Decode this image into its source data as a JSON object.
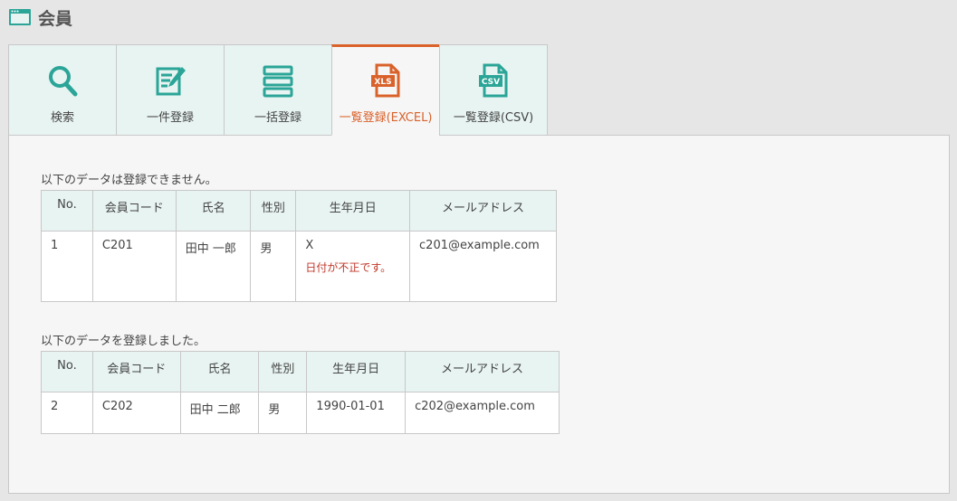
{
  "page": {
    "title": "会員"
  },
  "tabs": [
    {
      "label": "検索",
      "icon": "search-icon"
    },
    {
      "label": "一件登録",
      "icon": "edit-icon"
    },
    {
      "label": "一括登録",
      "icon": "list-icon"
    },
    {
      "label": "一覧登録(EXCEL)",
      "icon": "xls-file-icon",
      "icon_text": "XLS"
    },
    {
      "label": "一覧登録(CSV)",
      "icon": "csv-file-icon",
      "icon_text": "CSV"
    }
  ],
  "active_tab": "一覧登録(EXCEL)",
  "colors": {
    "accent": "#d9622b",
    "teal": "#2aa597",
    "error": "#c0392b"
  },
  "failed": {
    "message": "以下のデータは登録できません。",
    "headers": [
      "No.",
      "会員コード",
      "氏名",
      "性別",
      "生年月日",
      "メールアドレス"
    ],
    "rows": [
      {
        "no": "1",
        "code": "C201",
        "name": "田中 一郎",
        "gender": "男",
        "birth": "X",
        "error": "日付が不正です。",
        "email": "c201@example.com"
      }
    ]
  },
  "success": {
    "message": "以下のデータを登録しました。",
    "headers": [
      "No.",
      "会員コード",
      "氏名",
      "性別",
      "生年月日",
      "メールアドレス"
    ],
    "rows": [
      {
        "no": "2",
        "code": "C202",
        "name": "田中 二郎",
        "gender": "男",
        "birth": "1990-01-01",
        "email": "c202@example.com"
      }
    ]
  }
}
